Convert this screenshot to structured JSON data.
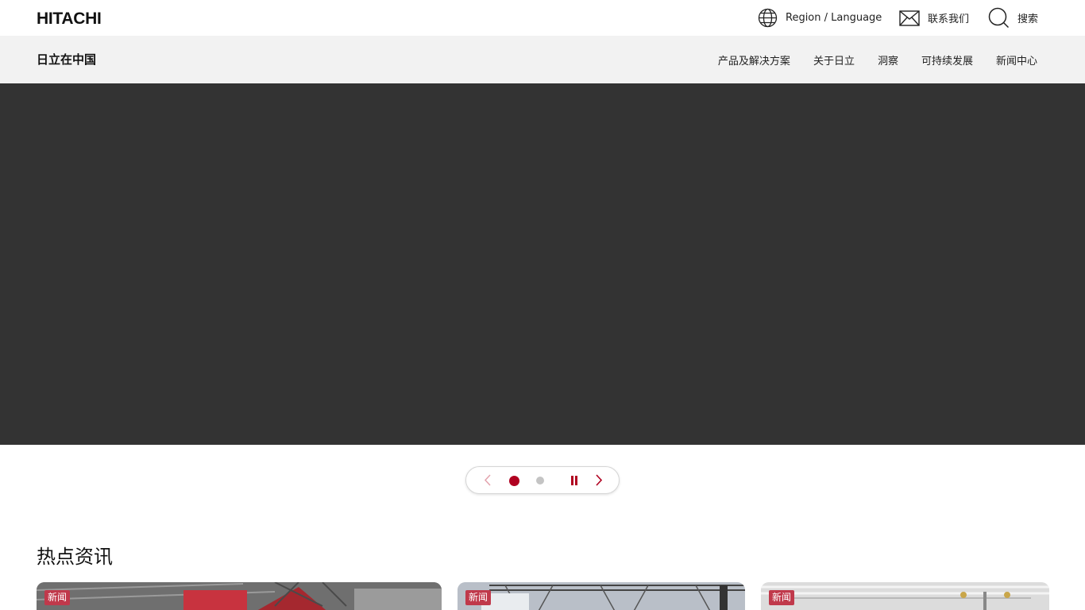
{
  "header": {
    "logo": "HITACHI",
    "region_label": "Region / Language",
    "contact_label": "联系我们",
    "search_label": "搜索"
  },
  "subnav": {
    "site_title": "日立在中国",
    "items": [
      {
        "label": "产品及解决方案"
      },
      {
        "label": "关于日立"
      },
      {
        "label": "洞察"
      },
      {
        "label": "可持续发展"
      },
      {
        "label": "新闻中心"
      }
    ]
  },
  "hero": {
    "background": "#333333"
  },
  "carousel": {
    "slide_count": 2,
    "active_slide": 1,
    "accent": "#b00020"
  },
  "news": {
    "title": "热点资讯",
    "cards": [
      {
        "tag": "新闻"
      },
      {
        "tag": "新闻"
      },
      {
        "tag": "新闻"
      }
    ]
  },
  "colors": {
    "accent": "#b00020",
    "tag_bg": "#c0394b",
    "subnav_bg": "#f2f2f2"
  }
}
